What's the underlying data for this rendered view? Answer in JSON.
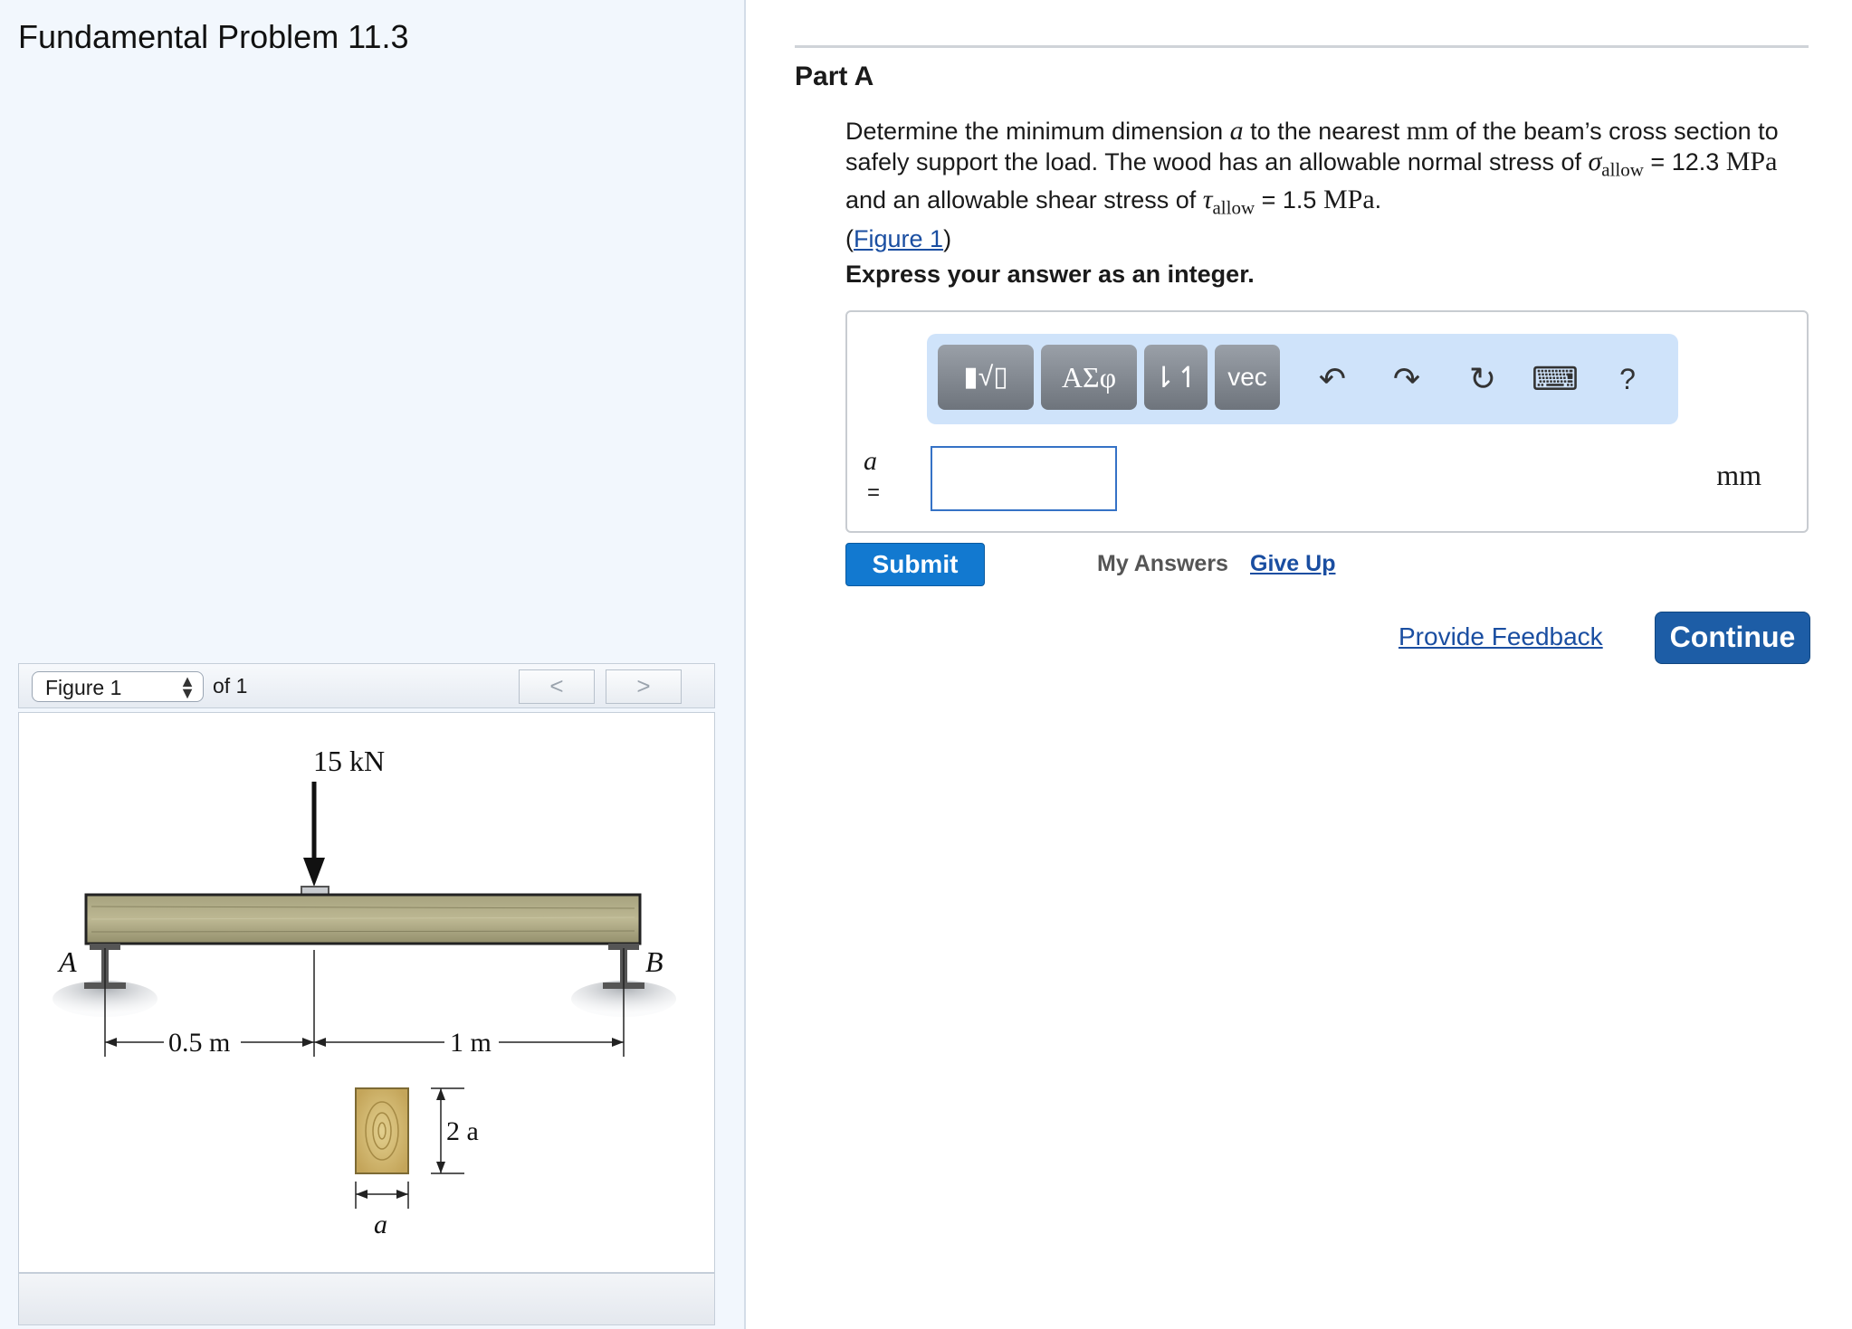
{
  "problem_title": "Fundamental Problem 11.3",
  "figure_nav": {
    "selected": "Figure 1",
    "of_label": "of 1",
    "prev_label": "<",
    "next_label": ">"
  },
  "figure": {
    "load_label": "15 kN",
    "support_a": "A",
    "support_b": "B",
    "dim_left": "0.5 m",
    "dim_right": "1 m",
    "height_label": "2 a",
    "width_label": "a"
  },
  "part": {
    "title": "Part A",
    "prompt": {
      "p1": "Determine the minimum dimension ",
      "var_a": "a",
      "p2": " to the nearest ",
      "unit_mm": "mm",
      "p3": " of the beam’s cross section to safely support the load. The wood has an allowable normal stress of ",
      "sigma": "σ",
      "allow": "allow",
      "eq1": " = 12.3 ",
      "unit_mpa1": "MPa",
      "p4": " and an allowable shear stress of ",
      "tau": "τ",
      "allow2": "allow",
      "eq2": " = 1.5 ",
      "unit_mpa2": "MPa",
      "p5": ".",
      "fig_open": "(",
      "fig_link": "Figure 1",
      "fig_close": ")"
    },
    "instruction": "Express your answer as an integer."
  },
  "toolbar": {
    "templates_icon": "▮√▯",
    "greek_label": "ΑΣφ",
    "arrows_label": "⇂↿",
    "vec_label": "vec",
    "undo_icon": "↶",
    "redo_icon": "↷",
    "reset_icon": "↻",
    "keyboard_icon": "⌨",
    "help_label": "?"
  },
  "answer": {
    "var": "a",
    "eq": "=",
    "value": "",
    "unit": "mm"
  },
  "actions": {
    "submit": "Submit",
    "my_answers": "My Answers",
    "give_up": "Give Up",
    "feedback": "Provide Feedback",
    "continue": "Continue"
  },
  "colors": {
    "accent_blue": "#1279d0",
    "continue_blue": "#1d5da6",
    "toolbar_bg": "#cfe3fa",
    "link_blue": "#1a4ea1"
  }
}
